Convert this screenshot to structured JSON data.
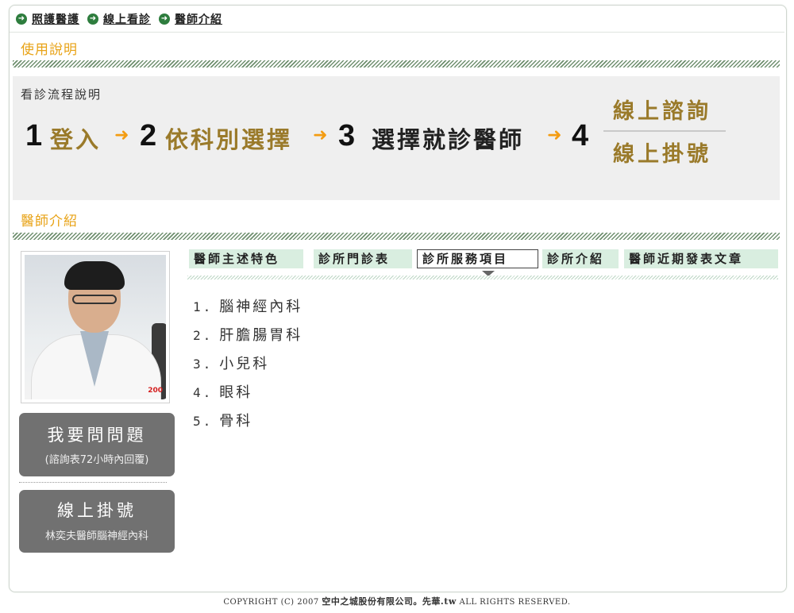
{
  "nav": {
    "items": [
      {
        "label": "照護醫護",
        "icon": "arrow-right-circle-icon"
      },
      {
        "label": "線上看診",
        "icon": "arrow-right-circle-icon"
      },
      {
        "label": "醫師介紹",
        "icon": "arrow-right-circle-icon"
      }
    ]
  },
  "usage": {
    "title": "使用說明",
    "caption": "看診流程說明",
    "steps": [
      {
        "num": "1",
        "text": "登入"
      },
      {
        "num": "2",
        "text": "依科別選擇"
      },
      {
        "num": "3",
        "text": "選擇就診醫師"
      },
      {
        "num": "4",
        "options": [
          "線上諮詢",
          "線上掛號"
        ]
      }
    ],
    "arrow_glyph": "➜"
  },
  "doctor": {
    "title": "醫師介紹",
    "photo_badge": "200",
    "ask_button": {
      "label": "我要問問題",
      "sub": "(諮詢表72小時內回覆)"
    },
    "register_button": {
      "label": "線上掛號",
      "sub": "林奕夫醫師腦神經內科"
    }
  },
  "tabs": {
    "items": [
      "醫師主述特色",
      "診所門診表",
      "診所服務項目",
      "診所介紹",
      "醫師近期發表文章"
    ],
    "active_index": 2
  },
  "services": [
    {
      "num": "1.",
      "label": "腦神經內科"
    },
    {
      "num": "2.",
      "label": "肝膽腸胃科"
    },
    {
      "num": "3.",
      "label": "小兒科"
    },
    {
      "num": "4.",
      "label": "眼科"
    },
    {
      "num": "5.",
      "label": "骨科"
    }
  ],
  "footer": {
    "prefix": "COPYRIGHT (C) 2007",
    "company": "空中之城股份有限公司。先華.tw",
    "suffix": "ALL RIGHTS RESERVED."
  },
  "colors": {
    "accent_orange": "#e8a317",
    "step_gold": "#9a7a2a",
    "arrow_orange": "#f39c12",
    "tab_green": "#d9eee0",
    "button_gray": "#717171",
    "nav_icon_green": "#2e7d3e"
  }
}
